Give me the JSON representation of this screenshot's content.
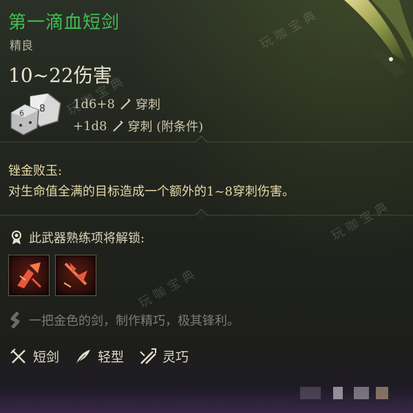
{
  "item": {
    "name": "第一滴血短剑",
    "rarity": "精良",
    "damage_range": "10~22伤害",
    "damage_lines": [
      {
        "dice": "1d6+8",
        "type": "穿刺",
        "icon": "piercing-icon"
      },
      {
        "dice": "+1d8",
        "type": "穿刺 (附条件)",
        "icon": "piercing-icon"
      }
    ]
  },
  "passive": {
    "name": "锉金败玉:",
    "description": "对生命值全满的目标造成一个额外的1~8穿刺伤害。"
  },
  "unlock": {
    "label": "此武器熟练项将解锁:",
    "actions": [
      {
        "name": "action-1",
        "icon": "weapon-action-icon"
      },
      {
        "name": "action-2",
        "icon": "weapon-action-icon"
      }
    ]
  },
  "flavor": "一把金色的剑，制作精巧，极其锋利。",
  "properties": [
    {
      "label": "短剑",
      "icon": "shortsword-icon"
    },
    {
      "label": "轻型",
      "icon": "feather-icon"
    },
    {
      "label": "灵巧",
      "icon": "finesse-icon"
    }
  ],
  "watermark": "玩咖宝典",
  "colors": {
    "title": "#3fbf52",
    "passive_text": "#e6d8a8",
    "body_text": "#ddd4bc",
    "flavor_text": "#7d7a72"
  }
}
